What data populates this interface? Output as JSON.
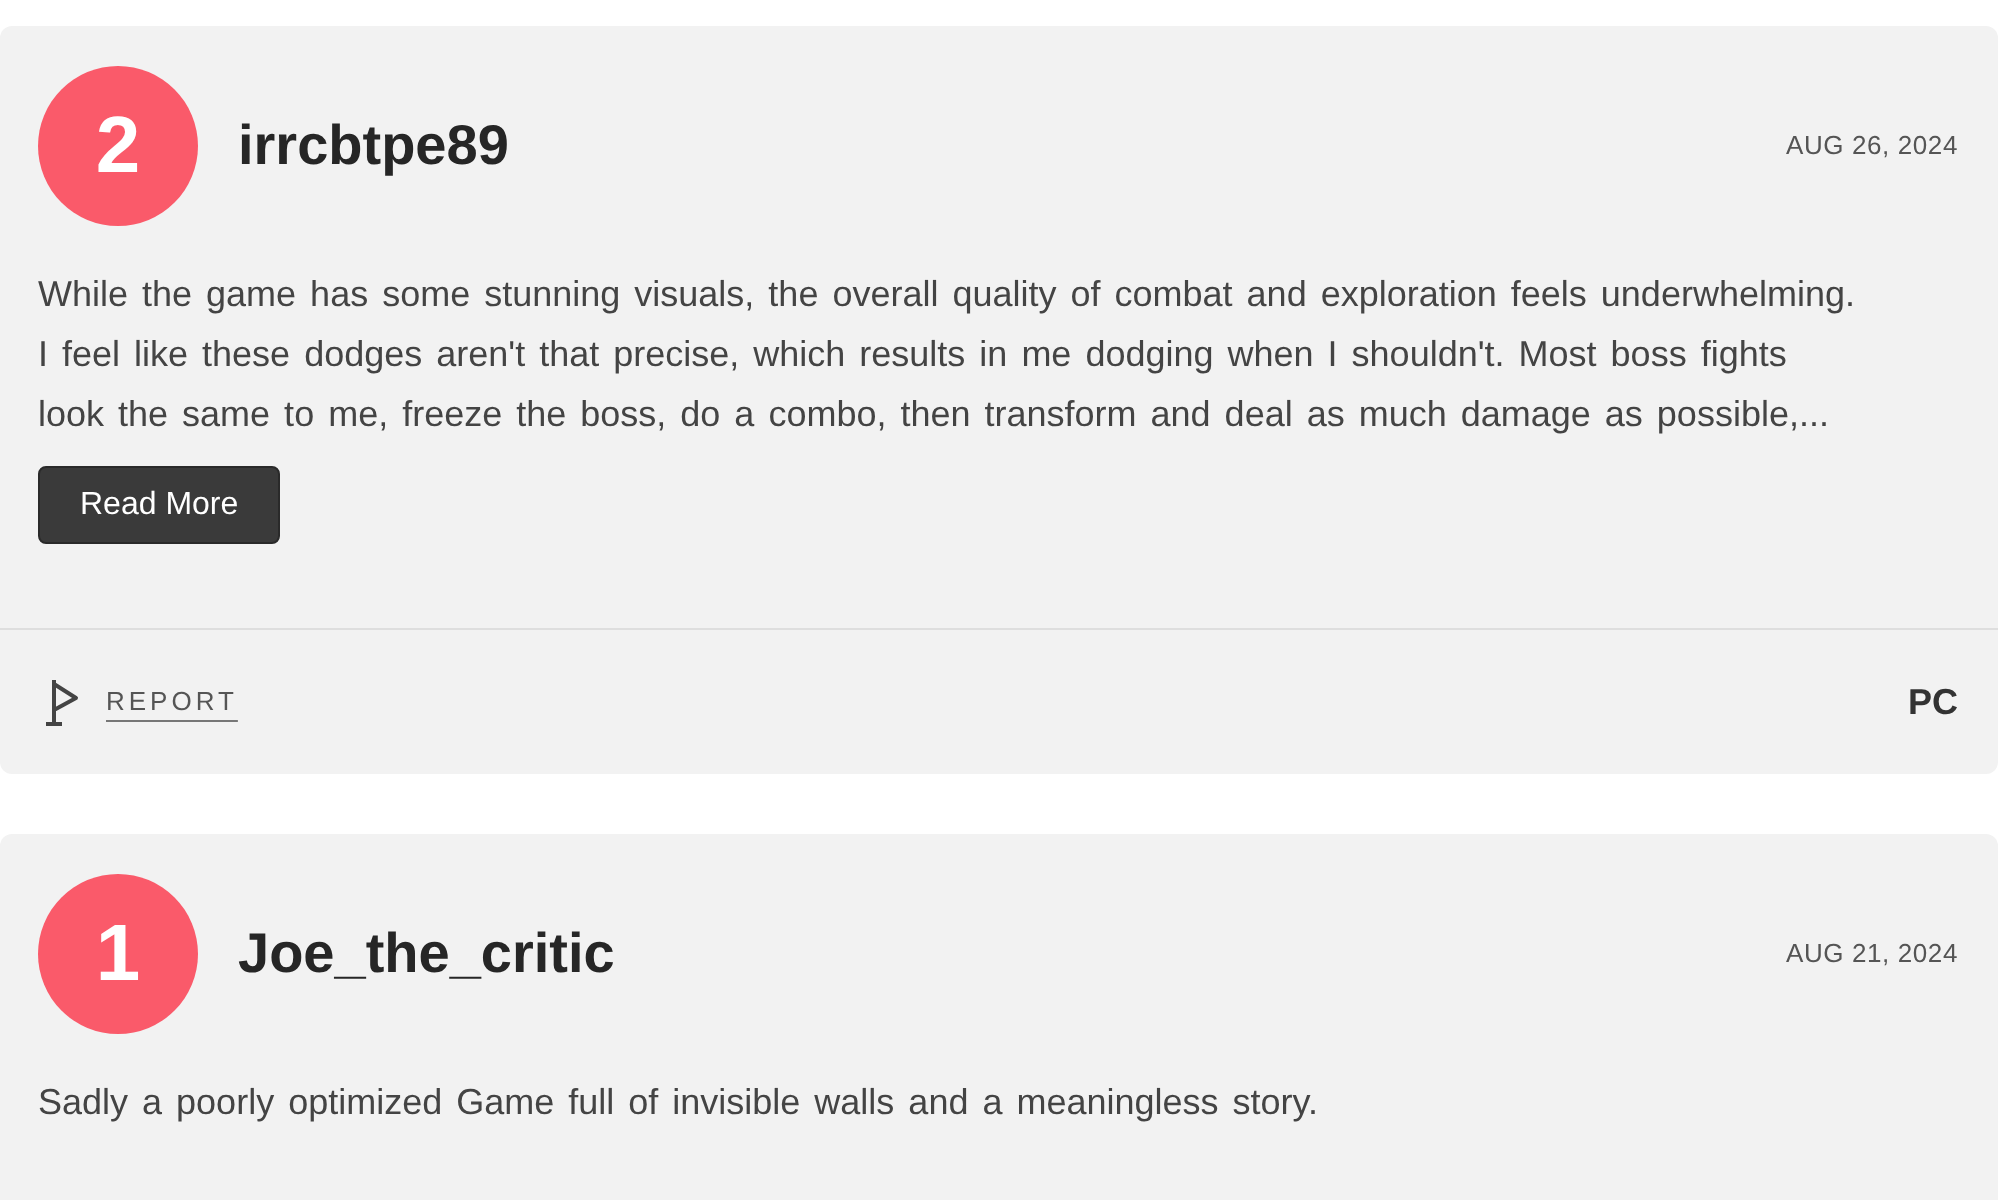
{
  "reviews": [
    {
      "score": "2",
      "username": "irrcbtpe89",
      "date": "AUG 26, 2024",
      "body": "While the game has some stunning visuals, the overall quality of combat and exploration feels underwhelming. I feel like these dodges aren't that precise, which results in me dodging when I shouldn't. Most boss fights look the same to me, freeze the boss, do a combo, then transform and deal as much damage as possible,...",
      "read_more": "Read More",
      "report": "REPORT",
      "platform": "PC"
    },
    {
      "score": "1",
      "username": "Joe_the_critic",
      "date": "AUG 21, 2024",
      "body": "Sadly a poorly optimized Game full of invisible walls and a meaningless story."
    }
  ]
}
